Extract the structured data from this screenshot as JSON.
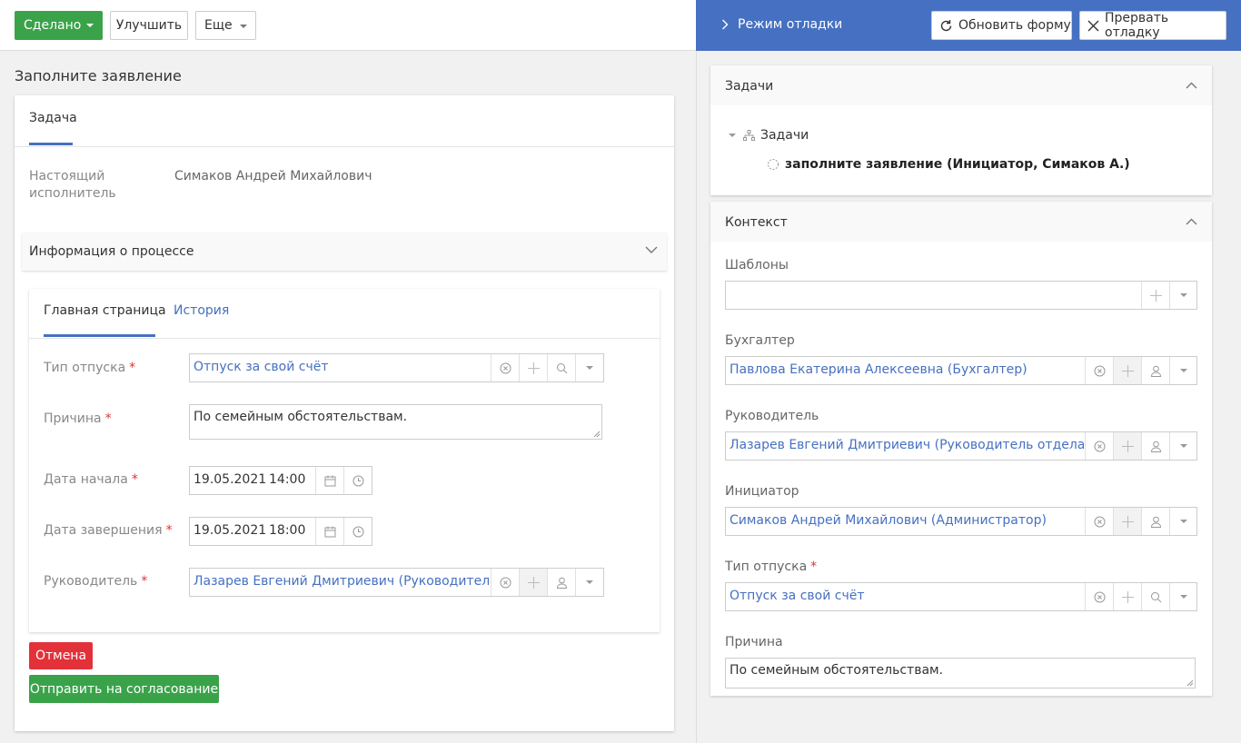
{
  "toolbar": {
    "done_label": "Сделано",
    "improve_label": "Улучшить",
    "more_label": "Еще"
  },
  "page": {
    "title": "Заполните заявление"
  },
  "task_card": {
    "tab_label": "Задача",
    "performer_label": "Настоящий исполнитель",
    "performer_value": "Симаков Андрей Михайлович",
    "process_info_label": "Информация о процессе"
  },
  "form": {
    "tabs": [
      "Главная страница",
      "История"
    ],
    "vacation_type": {
      "label": "Тип отпуска",
      "value": "Отпуск за свой счёт"
    },
    "reason": {
      "label": "Причина",
      "value": "По семейным обстоятельствам."
    },
    "start_date": {
      "label": "Дата начала",
      "date": "19.05.2021",
      "time": "14:00"
    },
    "end_date": {
      "label": "Дата завершения",
      "date": "19.05.2021",
      "time": "18:00"
    },
    "manager": {
      "label": "Руководитель",
      "value": "Лазарев Евгений Дмитриевич (Руководитель отдела продаж)"
    },
    "required_mark": "*"
  },
  "actions": {
    "cancel_label": "Отмена",
    "send_label": "Отправить на согласование"
  },
  "debug": {
    "title": "Режим отладки",
    "refresh_label": "Обновить форму",
    "abort_label": "Прервать отладку",
    "tasks": {
      "title": "Задачи",
      "root_label": "Задачи",
      "child_label": "заполните заявление (Инициатор, Симаков А.)"
    },
    "context": {
      "title": "Контекст",
      "templates_label": "Шаблоны",
      "templates_value": "",
      "accountant_label": "Бухгалтер",
      "accountant_value": "Павлова Екатерина Алексеевна (Бухгалтер)",
      "manager_label": "Руководитель",
      "manager_value": "Лазарев Евгений Дмитриевич (Руководитель отдела продаж)",
      "initiator_label": "Инициатор",
      "initiator_value": "Симаков Андрей Михайлович (Администратор)",
      "vacation_type_label": "Тип отпуска",
      "vacation_type_value": "Отпуск за свой счёт",
      "reason_label": "Причина",
      "reason_value": "По семейным обстоятельствам."
    }
  },
  "colors": {
    "accent": "#4670c1",
    "success": "#3aa34a",
    "danger": "#e3313a",
    "required": "#dd3333"
  }
}
